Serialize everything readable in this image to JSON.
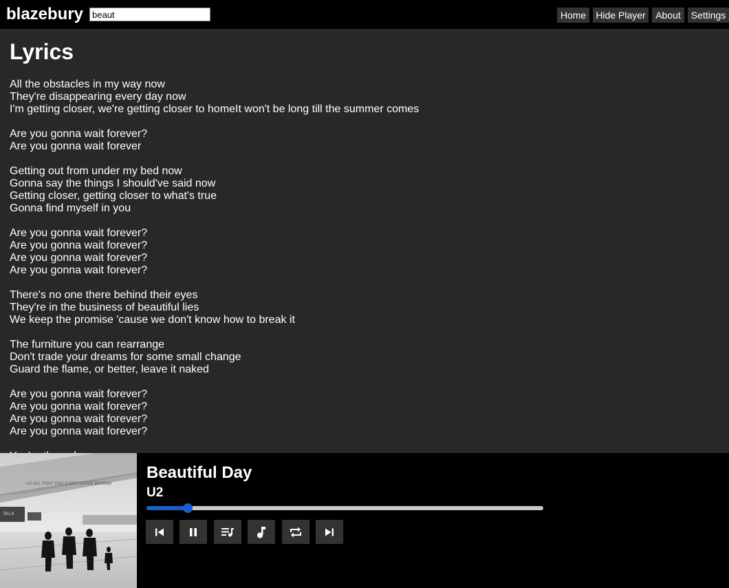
{
  "header": {
    "brand": "blazebury",
    "search_value": "beaut",
    "nav": [
      {
        "label": "Home"
      },
      {
        "label": "Hide Player"
      },
      {
        "label": "About"
      },
      {
        "label": "Settings"
      }
    ]
  },
  "lyrics_page": {
    "title": "Lyrics",
    "text": "All the obstacles in my way now\nThey're disappearing every day now\nI'm getting closer, we're getting closer to homeIt won't be long till the summer comes\n\nAre you gonna wait forever?\nAre you gonna wait forever\n\nGetting out from under my bed now\nGonna say the things I should've said now\nGetting closer, getting closer to what's true\nGonna find myself in you\n\nAre you gonna wait forever?\nAre you gonna wait forever?\nAre you gonna wait forever?\nAre you gonna wait forever?\n\nThere's no one there behind their eyes\nThey're in the business of beautiful lies\nWe keep the promise 'cause we don't know how to break it\n\nThe furniture you can rearrange\nDon't trade your dreams for some small change\nGuard the flame, or better, leave it naked\n\nAre you gonna wait forever?\nAre you gonna wait forever?\nAre you gonna wait forever?\nAre you gonna wait forever?\n\nYou're the only one"
  },
  "player": {
    "album_art_caption": "U2 ALL THAT YOU CAN'T LEAVE BEHIND",
    "album_art_sign": "7B1-8",
    "track_title": "Beautiful Day",
    "artist": "U2",
    "progress_fraction": 0.104,
    "controls": [
      {
        "icon": "skip-previous-icon"
      },
      {
        "icon": "pause-icon"
      },
      {
        "icon": "queue-music-icon"
      },
      {
        "icon": "music-note-icon"
      },
      {
        "icon": "repeat-icon"
      },
      {
        "icon": "skip-next-icon"
      }
    ],
    "colors": {
      "progress_fill": "#1a5fc9",
      "progress_track": "#c8c8c8",
      "button_bg": "#333333"
    }
  }
}
